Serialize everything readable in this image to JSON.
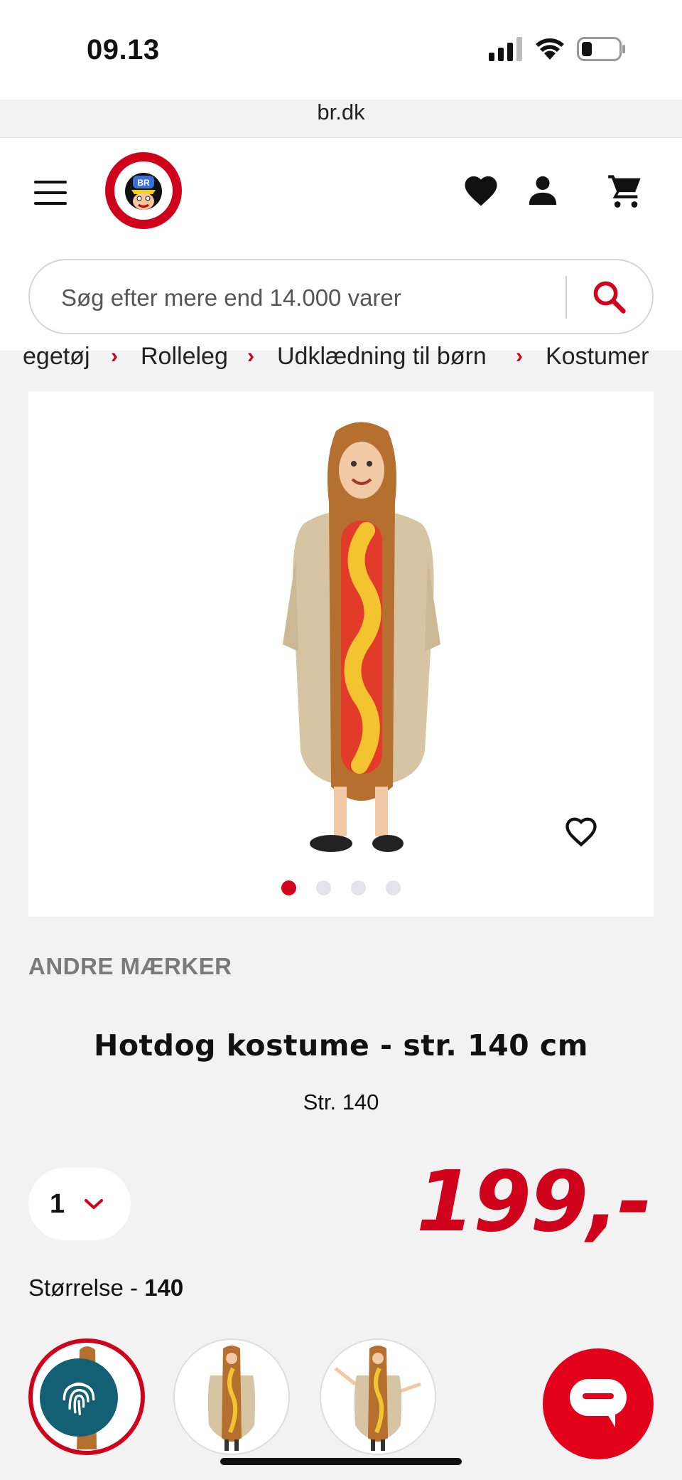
{
  "status_bar": {
    "time": "09.13"
  },
  "browser": {
    "url": "br.dk"
  },
  "search": {
    "placeholder": "Søg efter mere end 14.000 varer"
  },
  "breadcrumb": [
    "egetøj",
    "Rolleleg",
    "Udklædning til børn",
    "Kostumer"
  ],
  "product": {
    "brand": "ANDRE MÆRKER",
    "title": "Hotdog kostume - str. 140 cm",
    "subtitle": "Str. 140",
    "quantity": "1",
    "price": "199,-",
    "size_label": "Størrelse - ",
    "size_value": "140",
    "image_count": 4,
    "active_image": 1
  },
  "colors": {
    "brand_red": "#d0021b",
    "fingerprint_bg": "#135f74",
    "page_bg": "#f2f2f2"
  },
  "icons": [
    "menu-icon",
    "br-logo",
    "heart-icon",
    "user-icon",
    "cart-icon",
    "search-icon",
    "favorite-outline-icon",
    "fingerprint-icon",
    "chat-icon"
  ]
}
